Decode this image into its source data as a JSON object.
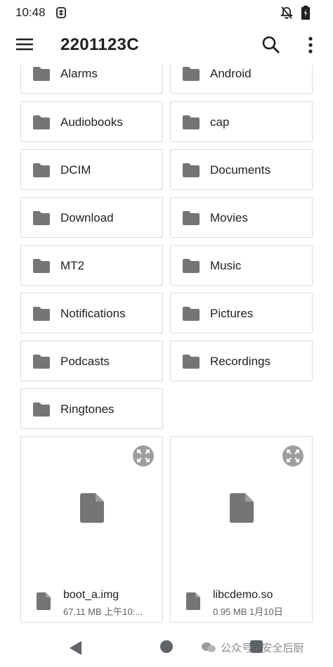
{
  "status_bar": {
    "time": "10:48"
  },
  "app_bar": {
    "title": "2201123C"
  },
  "directories": [
    {
      "label": "Alarms"
    },
    {
      "label": "Android"
    },
    {
      "label": "Audiobooks"
    },
    {
      "label": "cap"
    },
    {
      "label": "DCIM"
    },
    {
      "label": "Documents"
    },
    {
      "label": "Download"
    },
    {
      "label": "Movies"
    },
    {
      "label": "MT2"
    },
    {
      "label": "Music"
    },
    {
      "label": "Notifications"
    },
    {
      "label": "Pictures"
    },
    {
      "label": "Podcasts"
    },
    {
      "label": "Recordings"
    },
    {
      "label": "Ringtones"
    }
  ],
  "files": [
    {
      "name": "boot_a.img",
      "meta": "67.11 MB 上午10:..."
    },
    {
      "name": "libcdemo.so",
      "meta": "0.95 MB 1月10日"
    }
  ],
  "watermark": {
    "text": "公众号 · 安全后厨"
  },
  "colors": {
    "icon_gray": "#757575",
    "border": "#dadce0",
    "text": "#202124"
  }
}
